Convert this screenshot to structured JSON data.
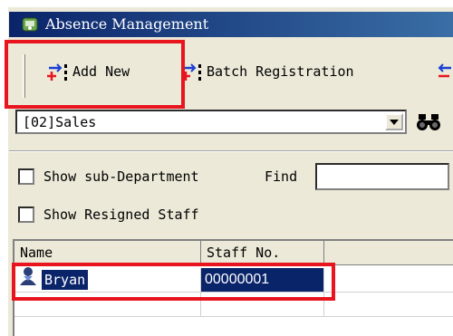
{
  "window": {
    "title": "Absence Management",
    "icon": "app-icon"
  },
  "toolbar": {
    "add_new_label": "Add New",
    "batch_label": "Batch Registration",
    "more_icon": "arrows-icon"
  },
  "department": {
    "selected": "[02]Sales",
    "find_icon": "binoculars-icon"
  },
  "filters": {
    "show_sub_label": "Show sub-Department",
    "show_sub_checked": false,
    "find_label": "Find",
    "find_value": "",
    "show_resigned_label": "Show Resigned Staff",
    "show_resigned_checked": false
  },
  "grid": {
    "columns": [
      "Name",
      "Staff No."
    ],
    "rows": [
      {
        "name": "Bryan",
        "staff_no": "00000001",
        "selected": true
      }
    ]
  },
  "colors": {
    "highlight": "#e8141e",
    "selection": "#0a246a",
    "titlebar": "#0a246a"
  }
}
